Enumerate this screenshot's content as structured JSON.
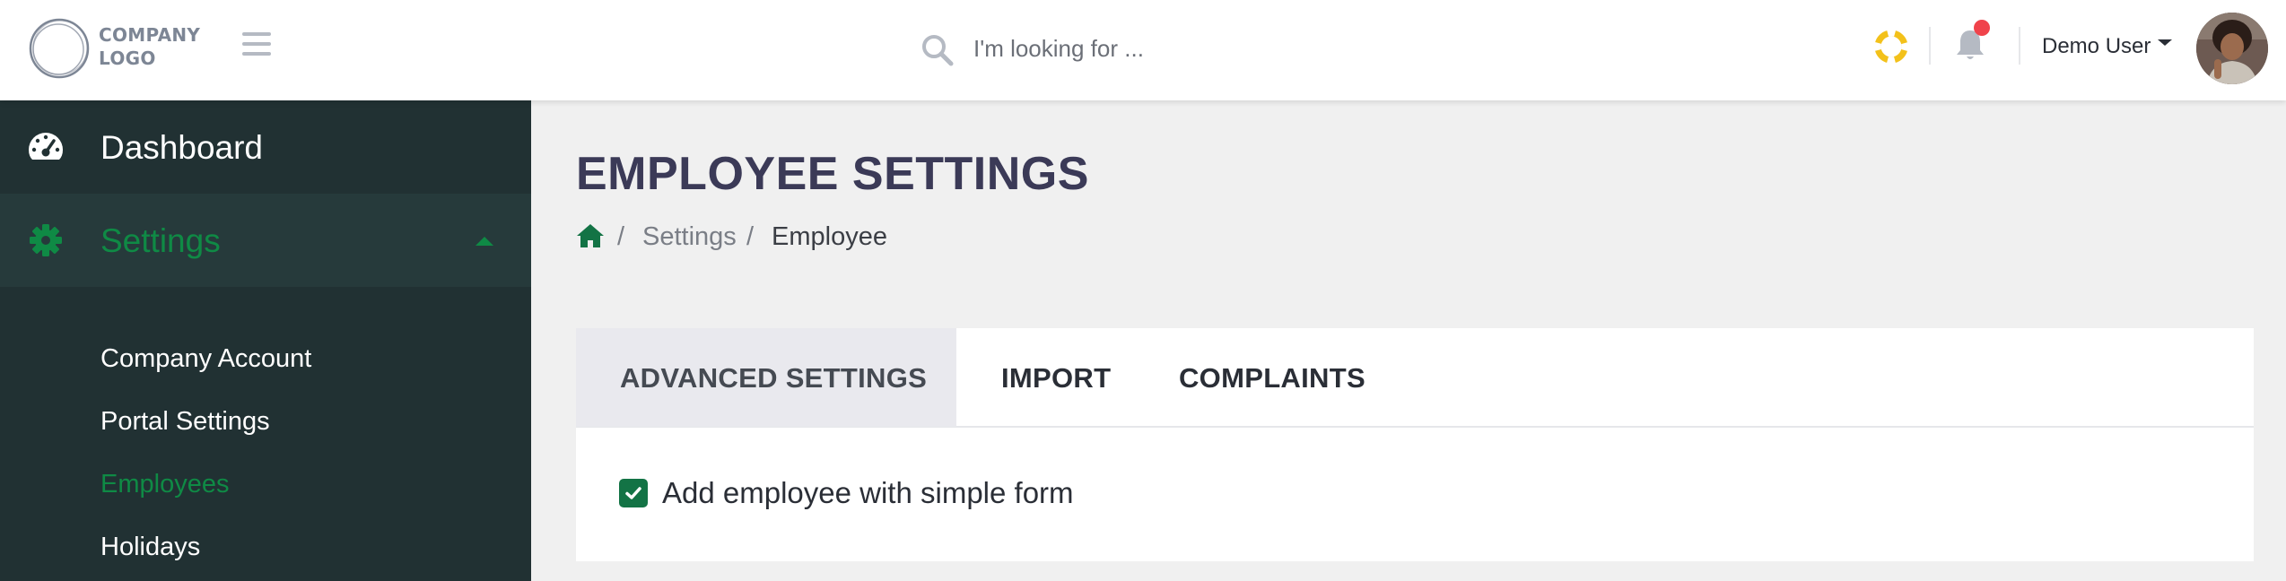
{
  "header": {
    "logo_line1": "COMPANY",
    "logo_line2": "LOGO",
    "search_placeholder": "I'm looking for ...",
    "user_name": "Demo User",
    "notification_dot_color": "#f0434b",
    "help_icon_color": "#f3c11a"
  },
  "sidebar": {
    "items": [
      {
        "label": "Dashboard",
        "icon": "dashboard-gauge-icon"
      },
      {
        "label": "Settings",
        "icon": "gear-icon",
        "expanded": true
      }
    ],
    "sub_items": [
      {
        "label": "Company Account"
      },
      {
        "label": "Portal Settings"
      },
      {
        "label": "Employees",
        "active": true
      },
      {
        "label": "Holidays"
      }
    ]
  },
  "main": {
    "title": "EMPLOYEE SETTINGS",
    "breadcrumb": {
      "separator": "/",
      "link": "Settings",
      "current": "Employee"
    },
    "tabs": [
      {
        "label": "ADVANCED SETTINGS",
        "active": true
      },
      {
        "label": "IMPORT"
      },
      {
        "label": "COMPLAINTS"
      }
    ],
    "options": {
      "simple_form_label": "Add employee with simple form",
      "simple_form_checked": true
    }
  },
  "colors": {
    "accent_green": "#0f8a45",
    "sidebar_bg": "#213133",
    "title_color": "#3b3a57"
  }
}
